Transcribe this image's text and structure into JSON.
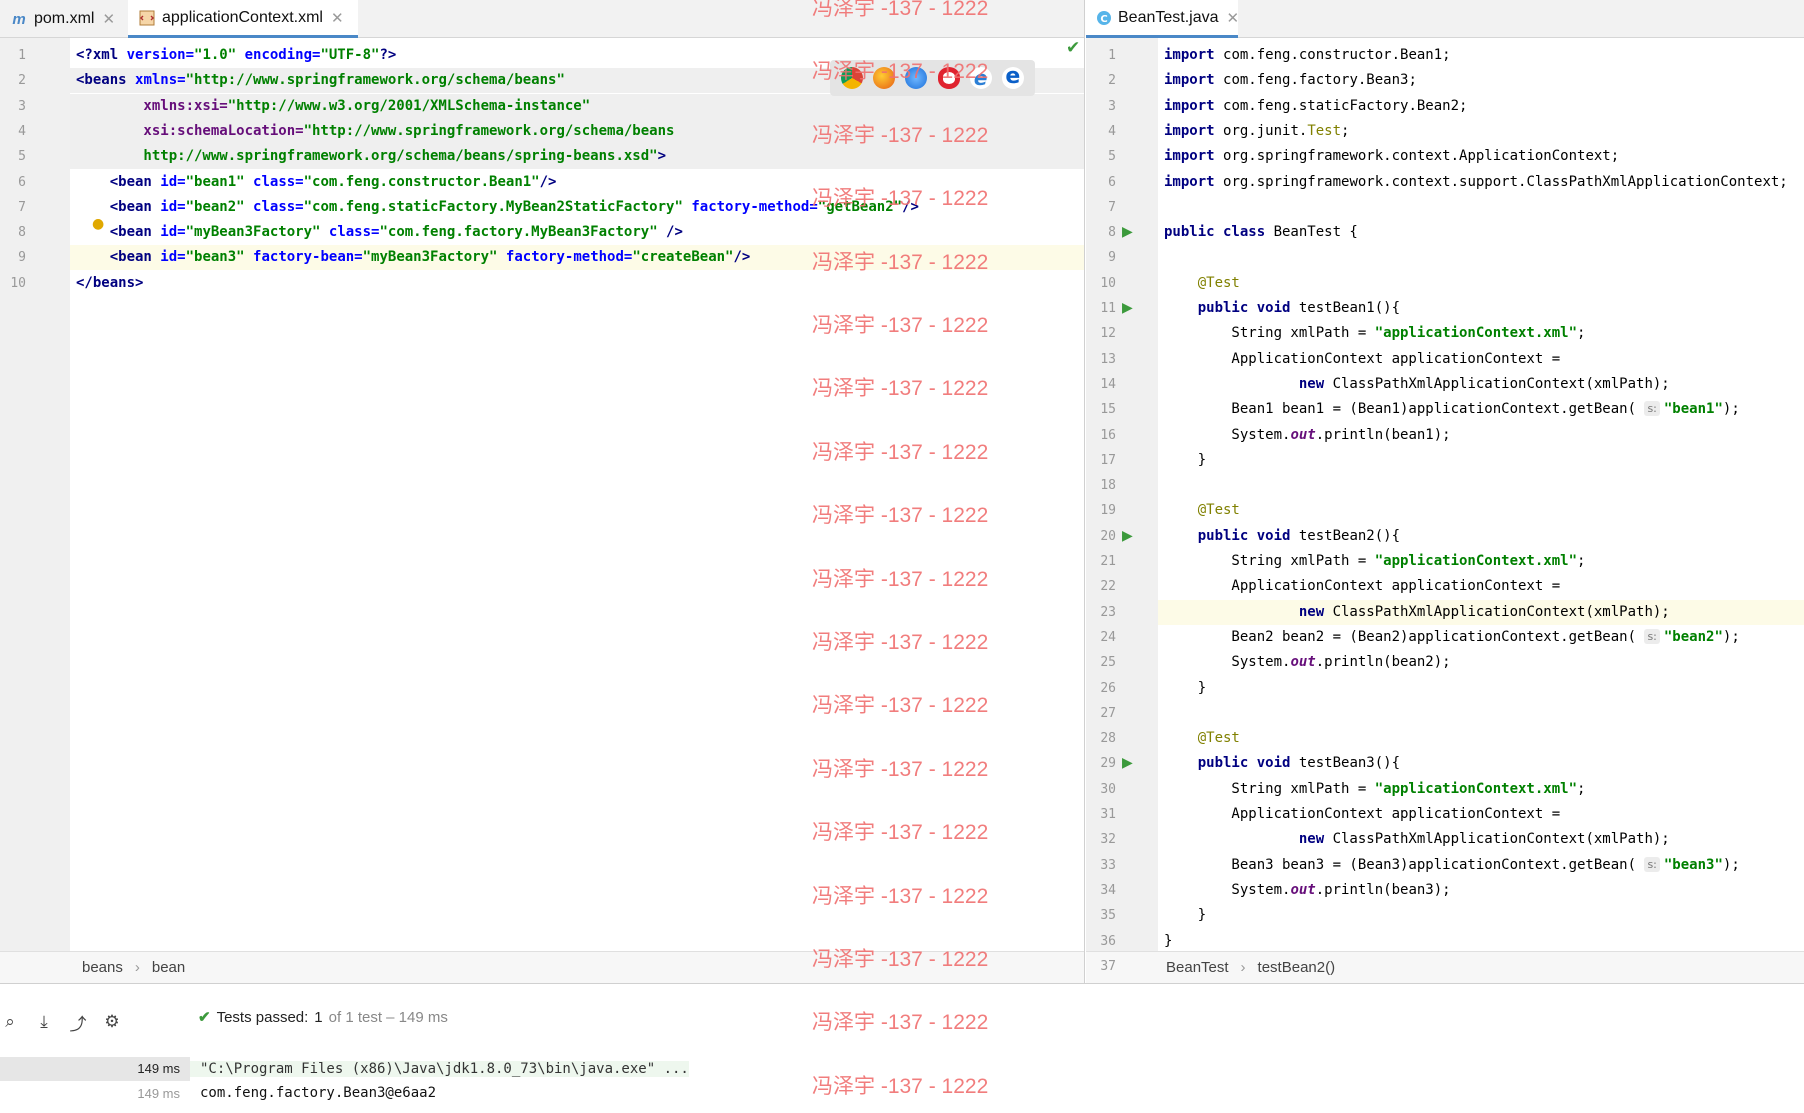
{
  "left_editor": {
    "tabs": [
      {
        "label": "pom.xml",
        "icon": "maven-icon"
      },
      {
        "label": "applicationContext.xml",
        "icon": "xml-file-icon"
      }
    ],
    "line_numbers": [
      "1",
      "2",
      "3",
      "4",
      "5",
      "6",
      "7",
      "8",
      "9",
      "10"
    ],
    "lines": [
      [
        [
          "<?",
          "xml-tag"
        ],
        [
          "xml ",
          "xml-tag"
        ],
        [
          "version=",
          "xml-attr"
        ],
        [
          "\"1.0\" ",
          "xml-val"
        ],
        [
          "encoding=",
          "xml-attr"
        ],
        [
          "\"UTF-8\"",
          "xml-val"
        ],
        [
          "?>",
          "xml-tag"
        ]
      ],
      [
        [
          "<beans ",
          "xml-tag"
        ],
        [
          "xmlns=",
          "xml-attr"
        ],
        [
          "\"http://www.springframework.org/schema/beans\"",
          "xml-val"
        ]
      ],
      [
        [
          "        xmlns:xsi=",
          "xml-ns"
        ],
        [
          "\"http://www.w3.org/2001/XMLSchema-instance\"",
          "xml-val"
        ]
      ],
      [
        [
          "        xsi:schemaLocation=",
          "xml-ns"
        ],
        [
          "\"http://www.springframework.org/schema/beans",
          "xml-val"
        ]
      ],
      [
        [
          "        http://www.springframework.org/schema/beans/spring-beans.xsd\"",
          "xml-val"
        ],
        [
          ">",
          "xml-tag"
        ]
      ],
      [
        [
          "    <bean ",
          "xml-tag"
        ],
        [
          "id=",
          "xml-attr"
        ],
        [
          "\"bean1\" ",
          "xml-val"
        ],
        [
          "class=",
          "xml-attr"
        ],
        [
          "\"com.feng.constructor.Bean1\"",
          "xml-val"
        ],
        [
          "/>",
          "xml-tag"
        ]
      ],
      [
        [
          "    <bean ",
          "xml-tag"
        ],
        [
          "id=",
          "xml-attr"
        ],
        [
          "\"bean2\" ",
          "xml-val"
        ],
        [
          "class=",
          "xml-attr"
        ],
        [
          "\"com.feng.staticFactory.MyBean2StaticFactory\" ",
          "xml-val"
        ],
        [
          "factory-method=",
          "xml-attr"
        ],
        [
          "\"getBean2\"",
          "xml-val"
        ],
        [
          "/>",
          "xml-tag"
        ]
      ],
      [
        [
          "    <bean ",
          "xml-tag"
        ],
        [
          "id=",
          "xml-attr"
        ],
        [
          "\"myBean3Factory\" ",
          "xml-val"
        ],
        [
          "class=",
          "xml-attr"
        ],
        [
          "\"com.feng.factory.MyBean3Factory\" ",
          "xml-val"
        ],
        [
          "/>",
          "xml-tag"
        ]
      ],
      [
        [
          "    <bean ",
          "xml-tag"
        ],
        [
          "id=",
          "xml-attr"
        ],
        [
          "\"bean3\" ",
          "xml-val"
        ],
        [
          "factory-bean=",
          "xml-attr"
        ],
        [
          "\"myBean3Factory\" ",
          "xml-val"
        ],
        [
          "factory-method=",
          "xml-attr"
        ],
        [
          "\"createBean\"",
          "xml-val"
        ],
        [
          "/>",
          "xml-tag"
        ]
      ],
      [
        [
          "</beans>",
          "xml-tag"
        ]
      ]
    ],
    "breadcrumb": [
      "beans",
      "bean"
    ]
  },
  "right_editor": {
    "tabs": [
      {
        "label": "BeanTest.java",
        "icon": "java-class-icon"
      }
    ],
    "line_numbers": [
      "1",
      "2",
      "3",
      "4",
      "5",
      "6",
      "7",
      "8",
      "9",
      "10",
      "11",
      "12",
      "13",
      "14",
      "15",
      "16",
      "17",
      "18",
      "19",
      "20",
      "21",
      "22",
      "23",
      "24",
      "25",
      "26",
      "27",
      "28",
      "29",
      "30",
      "31",
      "32",
      "33",
      "34",
      "35",
      "36",
      "37"
    ],
    "lines": [
      [
        [
          "import ",
          "kw"
        ],
        [
          "com.feng.constructor.Bean1;",
          ""
        ]
      ],
      [
        [
          "import ",
          "kw"
        ],
        [
          "com.feng.factory.Bean3;",
          ""
        ]
      ],
      [
        [
          "import ",
          "kw"
        ],
        [
          "com.feng.staticFactory.Bean2;",
          ""
        ]
      ],
      [
        [
          "import ",
          "kw"
        ],
        [
          "org.junit.",
          ""
        ],
        [
          "Test",
          "cls"
        ],
        [
          ";",
          ""
        ]
      ],
      [
        [
          "import ",
          "kw"
        ],
        [
          "org.springframework.context.ApplicationContext;",
          ""
        ]
      ],
      [
        [
          "import ",
          "kw"
        ],
        [
          "org.springframework.context.support.ClassPathXmlApplicationContext;",
          ""
        ]
      ],
      [],
      [
        [
          "public class ",
          "kw"
        ],
        [
          "BeanTest {",
          ""
        ]
      ],
      [],
      [
        [
          "    ",
          ""
        ],
        [
          "@Test",
          "ann"
        ]
      ],
      [
        [
          "    ",
          ""
        ],
        [
          "public void ",
          "kw"
        ],
        [
          "testBean1(){",
          ""
        ]
      ],
      [
        [
          "        String xmlPath = ",
          ""
        ],
        [
          "\"applicationContext.xml\"",
          "str"
        ],
        [
          ";",
          ""
        ]
      ],
      [
        [
          "        ApplicationContext applicationContext =",
          ""
        ]
      ],
      [
        [
          "                ",
          ""
        ],
        [
          "new ",
          "kw"
        ],
        [
          "ClassPathXmlApplicationContext(xmlPath);",
          ""
        ]
      ],
      [
        [
          "        Bean1 bean1 = (Bean1)applicationContext.getBean( ",
          ""
        ],
        [
          "s:",
          "hint"
        ],
        [
          "\"bean1\"",
          "str"
        ],
        [
          ");",
          ""
        ]
      ],
      [
        [
          "        System.",
          ""
        ],
        [
          "out",
          "it"
        ],
        [
          ".println(bean1);",
          ""
        ]
      ],
      [
        [
          "    }",
          ""
        ]
      ],
      [],
      [
        [
          "    ",
          ""
        ],
        [
          "@Test",
          "ann"
        ]
      ],
      [
        [
          "    ",
          ""
        ],
        [
          "public void ",
          "kw"
        ],
        [
          "testBean2(){",
          ""
        ]
      ],
      [
        [
          "        String xmlPath = ",
          ""
        ],
        [
          "\"applicationContext.xml\"",
          "str"
        ],
        [
          ";",
          ""
        ]
      ],
      [
        [
          "        ApplicationContext applicationContext =",
          ""
        ]
      ],
      [
        [
          "                ",
          ""
        ],
        [
          "new ",
          "kw"
        ],
        [
          "ClassPathXmlApplicationContext(xmlPath);",
          ""
        ]
      ],
      [
        [
          "        Bean2 bean2 = (Bean2)applicationContext.getBean( ",
          ""
        ],
        [
          "s:",
          "hint"
        ],
        [
          "\"bean2\"",
          "str"
        ],
        [
          ");",
          ""
        ]
      ],
      [
        [
          "        System.",
          ""
        ],
        [
          "out",
          "it"
        ],
        [
          ".println(bean2);",
          ""
        ]
      ],
      [
        [
          "    }",
          ""
        ]
      ],
      [],
      [
        [
          "    ",
          ""
        ],
        [
          "@Test",
          "ann"
        ]
      ],
      [
        [
          "    ",
          ""
        ],
        [
          "public void ",
          "kw"
        ],
        [
          "testBean3(){",
          ""
        ]
      ],
      [
        [
          "        String xmlPath = ",
          ""
        ],
        [
          "\"applicationContext.xml\"",
          "str"
        ],
        [
          ";",
          ""
        ]
      ],
      [
        [
          "        ApplicationContext applicationContext =",
          ""
        ]
      ],
      [
        [
          "                ",
          ""
        ],
        [
          "new ",
          "kw"
        ],
        [
          "ClassPathXmlApplicationContext(xmlPath);",
          ""
        ]
      ],
      [
        [
          "        Bean3 bean3 = (Bean3)applicationContext.getBean( ",
          ""
        ],
        [
          "s:",
          "hint"
        ],
        [
          "\"bean3\"",
          "str"
        ],
        [
          ");",
          ""
        ]
      ],
      [
        [
          "        System.",
          ""
        ],
        [
          "out",
          "it"
        ],
        [
          ".println(bean3);",
          ""
        ]
      ],
      [
        [
          "    }",
          ""
        ]
      ],
      [
        [
          "}",
          ""
        ]
      ],
      []
    ],
    "breadcrumb": [
      "BeanTest",
      "testBean2()"
    ]
  },
  "run_panel": {
    "status_prefix": "Tests passed:",
    "status_count": "1",
    "status_rest": "of 1 test – 149 ms",
    "output": [
      {
        "time": "149 ms",
        "text": "\"C:\\Program Files (x86)\\Java\\jdk1.8.0_73\\bin\\java.exe\" ..."
      },
      {
        "time": "149 ms",
        "text": "com.feng.factory.Bean3@e6aa2"
      }
    ]
  },
  "watermark": "冯泽宇 -137 - 1222",
  "colors": {
    "accent": "#4a88c7",
    "watermark": "#f07070",
    "pass_green": "#3c9a3c"
  }
}
